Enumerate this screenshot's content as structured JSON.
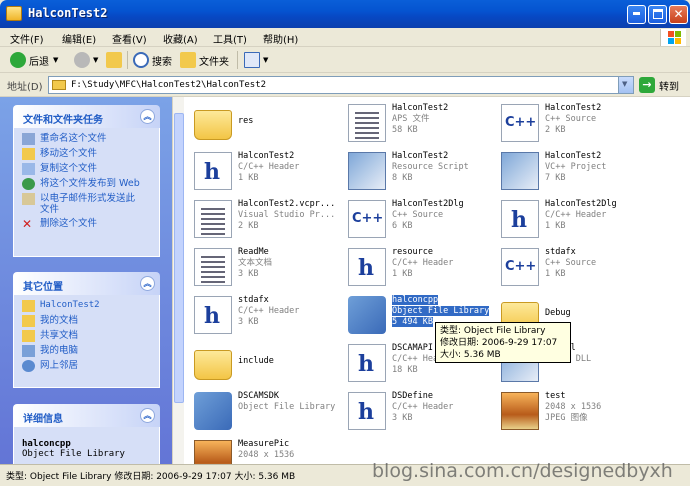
{
  "window": {
    "title": "HalconTest2"
  },
  "menu": [
    "文件(F)",
    "编辑(E)",
    "查看(V)",
    "收藏(A)",
    "工具(T)",
    "帮助(H)"
  ],
  "toolbar": {
    "back": "后退",
    "search": "搜索",
    "folders": "文件夹"
  },
  "address": {
    "label": "地址(D)",
    "path": "F:\\Study\\MFC\\HalconTest2\\HalconTest2",
    "go": "转到"
  },
  "tasks": {
    "title": "文件和文件夹任务",
    "items": [
      "重命名这个文件",
      "移动这个文件",
      "复制这个文件",
      "将这个文件发布到 Web",
      "以电子邮件形式发送此文件",
      "删除这个文件"
    ]
  },
  "places": {
    "title": "其它位置",
    "items": [
      "HalconTest2",
      "我的文档",
      "共享文档",
      "我的电脑",
      "网上邻居"
    ]
  },
  "details": {
    "title": "详细信息",
    "name": "halconcpp",
    "type": "Object File Library"
  },
  "files": [
    {
      "name": "res",
      "type": "",
      "size": "",
      "icon": "folder"
    },
    {
      "name": "HalconTest2",
      "type": "APS 文件",
      "size": "58 KB",
      "icon": "doc"
    },
    {
      "name": "HalconTest2",
      "type": "C++ Source",
      "size": "2 KB",
      "icon": "cpp"
    },
    {
      "name": "HalconTest2",
      "type": "C/C++ Header",
      "size": "1 KB",
      "icon": "h"
    },
    {
      "name": "HalconTest2",
      "type": "Resource Script",
      "size": "8 KB",
      "icon": "app"
    },
    {
      "name": "HalconTest2",
      "type": "VC++ Project",
      "size": "7 KB",
      "icon": "app"
    },
    {
      "name": "HalconTest2.vcpr...",
      "type": "Visual Studio Pr...",
      "size": "2 KB",
      "icon": "doc"
    },
    {
      "name": "HalconTest2Dlg",
      "type": "C++ Source",
      "size": "6 KB",
      "icon": "cpp"
    },
    {
      "name": "HalconTest2Dlg",
      "type": "C/C++ Header",
      "size": "1 KB",
      "icon": "h"
    },
    {
      "name": "ReadMe",
      "type": "文本文档",
      "size": "3 KB",
      "icon": "doc"
    },
    {
      "name": "resource",
      "type": "C/C++ Header",
      "size": "1 KB",
      "icon": "h"
    },
    {
      "name": "stdafx",
      "type": "C++ Source",
      "size": "1 KB",
      "icon": "cpp"
    },
    {
      "name": "stdafx",
      "type": "C/C++ Header",
      "size": "3 KB",
      "icon": "h"
    },
    {
      "name": "halconcpp",
      "type": "Object File Library",
      "size": "5 494 KB",
      "icon": "lib"
    },
    {
      "name": "Debug",
      "type": "",
      "size": "",
      "icon": "folder"
    },
    {
      "name": "include",
      "type": "",
      "size": "",
      "icon": "folder"
    },
    {
      "name": "DSCAMAPI",
      "type": "C/C++ Header",
      "size": "18 KB",
      "icon": "h"
    },
    {
      "name": "DK dll",
      "type": "",
      "size": "EB310 DLL",
      "icon": "app"
    },
    {
      "name": "DSCAMSDK",
      "type": "Object File Library",
      "size": "",
      "icon": "lib"
    },
    {
      "name": "DSDefine",
      "type": "C/C++ Header",
      "size": "3 KB",
      "icon": "h"
    },
    {
      "name": "test",
      "type": "2048 x 1536",
      "size": "JPEG 图像",
      "icon": "img"
    },
    {
      "name": "MeasurePic",
      "type": "2048 x 1536",
      "size": "",
      "icon": "img"
    }
  ],
  "tooltip": {
    "type": "类型: Object File Library",
    "date": "修改日期: 2006-9-29 17:07",
    "size": "大小: 5.36 MB"
  },
  "status": "类型: Object File Library 修改日期: 2006-9-29 17:07 大小: 5.36 MB",
  "watermark": "blog.sina.com.cn/designedbyxh"
}
